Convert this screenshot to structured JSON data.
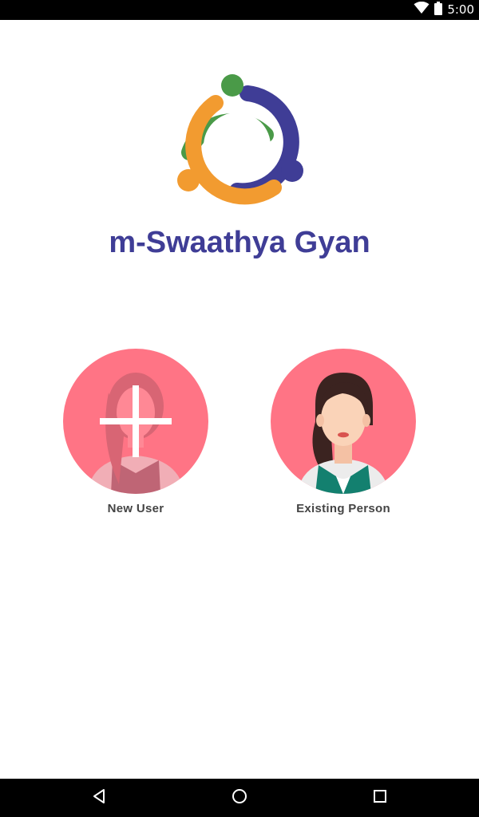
{
  "status_bar": {
    "time": "5:00",
    "icons": [
      "wifi-icon",
      "battery-icon"
    ]
  },
  "app": {
    "title": "m-Swaathya Gyan",
    "title_color": "#3f3d96",
    "logo": {
      "colors": [
        "#4a9a48",
        "#f29b30",
        "#3f3d96"
      ]
    }
  },
  "choices": {
    "new_user": {
      "label": "New User",
      "icon": "add-user-icon",
      "circle_color": "#ff7485"
    },
    "existing_person": {
      "label": "Existing Person",
      "icon": "woman-avatar-icon",
      "circle_color": "#ff7485"
    }
  },
  "nav_bar": {
    "buttons": [
      "back-icon",
      "home-icon",
      "recents-icon"
    ]
  }
}
